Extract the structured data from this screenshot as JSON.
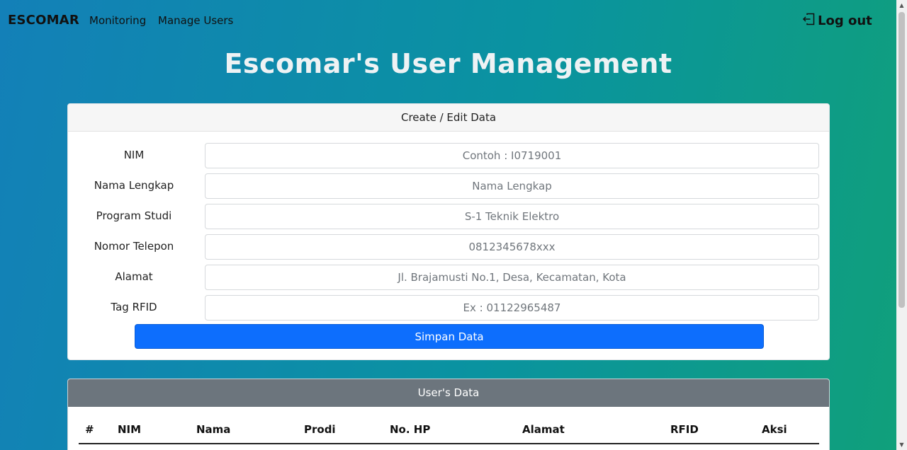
{
  "nav": {
    "brand": "ESCOMAR",
    "links": [
      "Monitoring",
      "Manage Users"
    ],
    "logout": "Log out"
  },
  "title": "Escomar's User Management",
  "form": {
    "header": "Create / Edit Data",
    "fields": [
      {
        "label": "NIM",
        "placeholder": "Contoh : I0719001"
      },
      {
        "label": "Nama Lengkap",
        "placeholder": "Nama Lengkap"
      },
      {
        "label": "Program Studi",
        "placeholder": "S-1 Teknik Elektro"
      },
      {
        "label": "Nomor Telepon",
        "placeholder": "0812345678xxx"
      },
      {
        "label": "Alamat",
        "placeholder": "Jl. Brajamusti No.1, Desa, Kecamatan, Kota"
      },
      {
        "label": "Tag RFID",
        "placeholder": "Ex : 01122965487"
      }
    ],
    "submit": "Simpan Data"
  },
  "table": {
    "header": "User's Data",
    "columns": [
      "#",
      "NIM",
      "Nama",
      "Prodi",
      "No. HP",
      "Alamat",
      "RFID",
      "Aksi"
    ]
  }
}
